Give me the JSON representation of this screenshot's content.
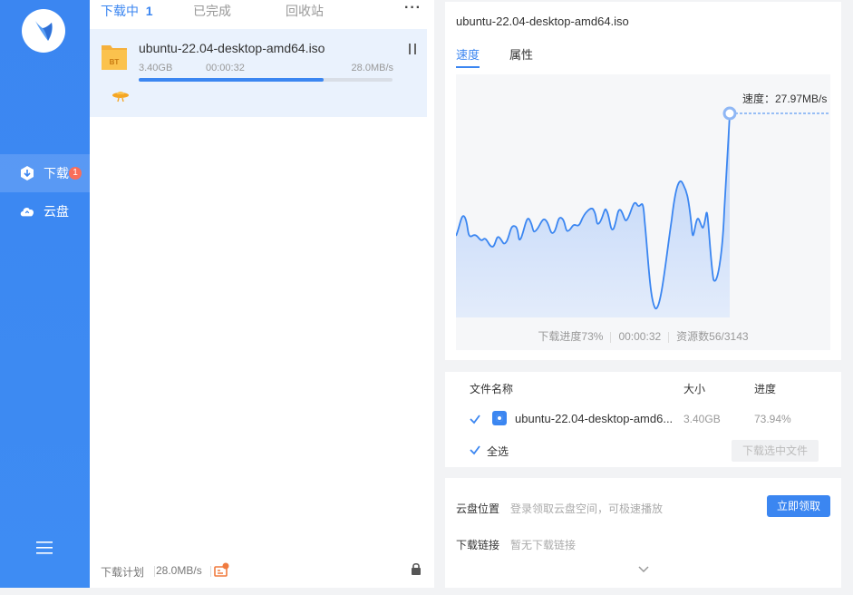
{
  "sidebar": {
    "items": [
      {
        "label": "下载",
        "badge": "1"
      },
      {
        "label": "云盘"
      }
    ]
  },
  "list": {
    "tabs": [
      {
        "label": "下载中",
        "count": "1"
      },
      {
        "label": "已完成"
      },
      {
        "label": "回收站"
      }
    ],
    "more": "···",
    "task": {
      "name": "ubuntu-22.04-desktop-amd64.iso",
      "file_badge": "BT",
      "size": "3.40GB",
      "elapsed": "00:00:32",
      "speed": "28.0MB/s",
      "progress": 0.73
    },
    "footer": {
      "plan": "下载计划",
      "speed": "28.0MB/s"
    }
  },
  "detail": {
    "title": "ubuntu-22.04-desktop-amd64.iso",
    "tabs": [
      "速度",
      "属性"
    ],
    "speed_label": "速度：27.97MB/s",
    "stats": {
      "progress": "下载进度73%",
      "elapsed": "00:00:32",
      "sources": "资源数56/3143"
    },
    "files": {
      "headers": {
        "name": "文件名称",
        "size": "大小",
        "progress": "进度"
      },
      "rows": [
        {
          "name": "ubuntu-22.04-desktop-amd6...",
          "size": "3.40GB",
          "progress": "73.94%"
        }
      ],
      "select_all": "全选",
      "download_selected": "下载选中文件"
    },
    "cloud": {
      "location_label": "云盘位置",
      "location_value": "登录领取云盘空间，可极速播放",
      "claim_button": "立即领取",
      "link_label": "下载链接",
      "link_value": "暂无下载链接"
    }
  },
  "colors": {
    "accent": "#3b86f1",
    "badge": "#f86e5a"
  }
}
